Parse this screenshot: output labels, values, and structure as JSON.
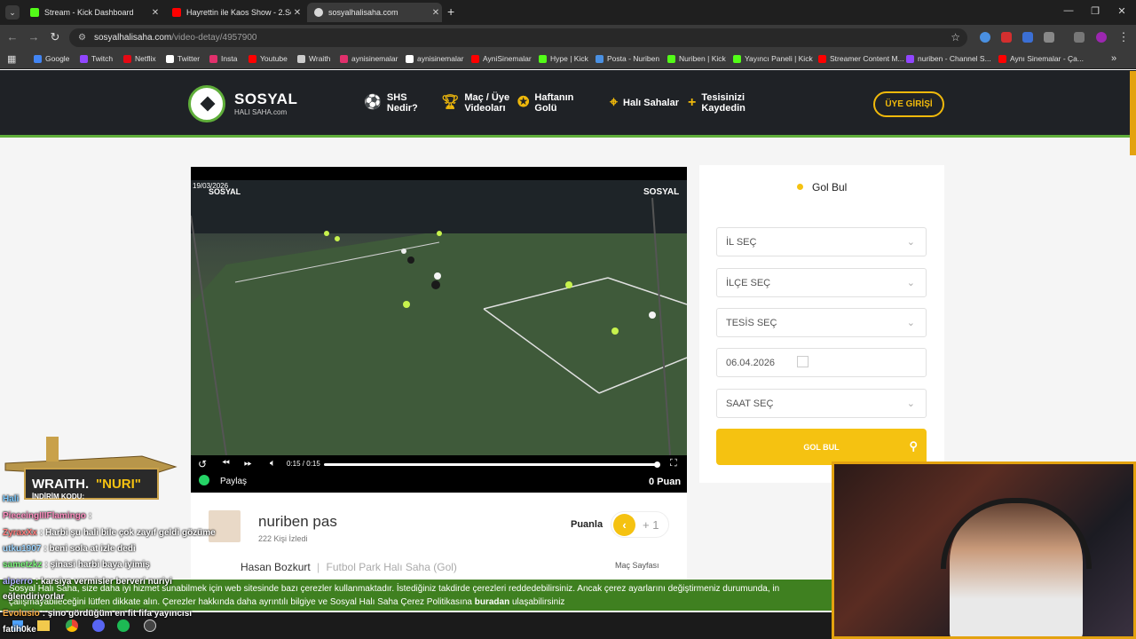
{
  "browser": {
    "tabs": [
      {
        "title": "Stream - Kick Dashboard",
        "color": "#53fc18"
      },
      {
        "title": "Hayrettin ile Kaos Show - 2.Sez",
        "color": "#ff0000"
      },
      {
        "title": "sosyalhalisaha.com",
        "color": "#cccccc"
      }
    ],
    "new_tab": "+",
    "url_host": "sosyalhalisaha.com",
    "url_path": "/video-detay/4957900",
    "bookmarks": [
      {
        "label": "Google",
        "color": "#4285f4"
      },
      {
        "label": "Twitch",
        "color": "#9146ff"
      },
      {
        "label": "Netflix",
        "color": "#e50914"
      },
      {
        "label": "Twitter",
        "color": "#ffffff"
      },
      {
        "label": "Insta",
        "color": "#e1306c"
      },
      {
        "label": "Youtube",
        "color": "#ff0000"
      },
      {
        "label": "Wraith",
        "color": "#cccccc"
      },
      {
        "label": "aynisinemalar",
        "color": "#e1306c"
      },
      {
        "label": "aynisinemalar",
        "color": "#ffffff"
      },
      {
        "label": "AyniSinemalar",
        "color": "#ff0000"
      },
      {
        "label": "Hype | Kick",
        "color": "#53fc18"
      },
      {
        "label": "Posta - Nuriben",
        "color": "#4a90e2"
      },
      {
        "label": "Nuriben | Kick",
        "color": "#53fc18"
      },
      {
        "label": "Yayıncı Paneli | Kick",
        "color": "#53fc18"
      },
      {
        "label": "Streamer Content M...",
        "color": "#ff0000"
      },
      {
        "label": "nuriben - Channel S...",
        "color": "#9146ff"
      },
      {
        "label": "Aynı Sinemalar - Ça...",
        "color": "#ff0000"
      }
    ],
    "more": "»"
  },
  "site": {
    "logo_main": "SOSYAL",
    "logo_sub": "HALI SAHA.com",
    "nav": [
      {
        "line1": "SHS",
        "line2": "Nedir?"
      },
      {
        "line1": "Maç / Üye",
        "line2": "Videoları"
      },
      {
        "line1": "Haftanın",
        "line2": "Golü"
      },
      {
        "line1": "Halı Sahalar",
        "line2": ""
      },
      {
        "line1": "Tesisinizi",
        "line2": "Kaydedin"
      }
    ],
    "login": "ÜYE GİRİŞİ"
  },
  "video": {
    "timestamp": "19/03/2026",
    "watermark": "SOSYAL",
    "time": "0:15 / 0:15",
    "progress": 1.0,
    "share": "Paylaş",
    "points": "0 Puan"
  },
  "info": {
    "title": "nuriben pas",
    "views": "222 Kişi İzledi",
    "rate_label": "Puanla",
    "rate_value": "+ 1",
    "player": "Hasan Bozkurt",
    "venue": "Futbol Park Halı Saha (Gol)",
    "match_page": "Maç Sayfası"
  },
  "sidebar": {
    "title": "Gol Bul",
    "selects": [
      "İL SEÇ",
      "İLÇE SEÇ",
      "TESİS SEÇ",
      "06.04.2026",
      "SAAT SEÇ"
    ],
    "button": "GOL BUL"
  },
  "cookie": {
    "line1": "Sosyal Halı Saha, size daha iyi hizmet sunabilmek için web sitesinde bazı çerezler kullanmaktadır. İstediğiniz takdirde çerezleri reddedebilirsiniz. Ancak çerez ayarlarını değiştirmeniz durumunda, in",
    "line2": "çalışmayabileceğini lütfen dikkate alın. Çerezler hakkında daha ayrıntılı bilgiye ve Sosyal Halı Saha Çerez Politikasına",
    "link": "buradan",
    "line2_end": "ulaşabilirsiniz"
  },
  "stream": {
    "badge_title": "WRAITH.",
    "badge_code": "\"NURI\"",
    "badge_sub": "İNDİRİM KODU:",
    "chat": [
      {
        "user": "Hali",
        "text": "",
        "color": "#7ecbff"
      },
      {
        "user": "PieceingIIIFlamingo",
        "text": ":",
        "color": "#ff8fc1"
      },
      {
        "user": "ZyraxXx",
        "text": ": Harbi şu hali bile çok zayıf geldi gözüme",
        "color": "#ff7b7b"
      },
      {
        "user": "utku1907",
        "text": ": beni sola at izle dedi",
        "color": "#9fd6ff"
      },
      {
        "user": "sametzkz",
        "text": ": şinasi harbi baya iyimiş",
        "color": "#7df77d"
      },
      {
        "user": "alperro",
        "text": ": karsiya vermisler berveri nuriyi",
        "color": "#b0b0ff"
      },
      {
        "user": "eğlendiriyorlar",
        "text": "",
        "color": "#ffffff"
      },
      {
        "user": "Evolusio",
        "text": ": şino gördüğüm en fit fifa yayıncısı",
        "color": "#ffb347"
      },
      {
        "user": "fatih0ke",
        "text": "",
        "color": "#ffffff"
      }
    ]
  }
}
